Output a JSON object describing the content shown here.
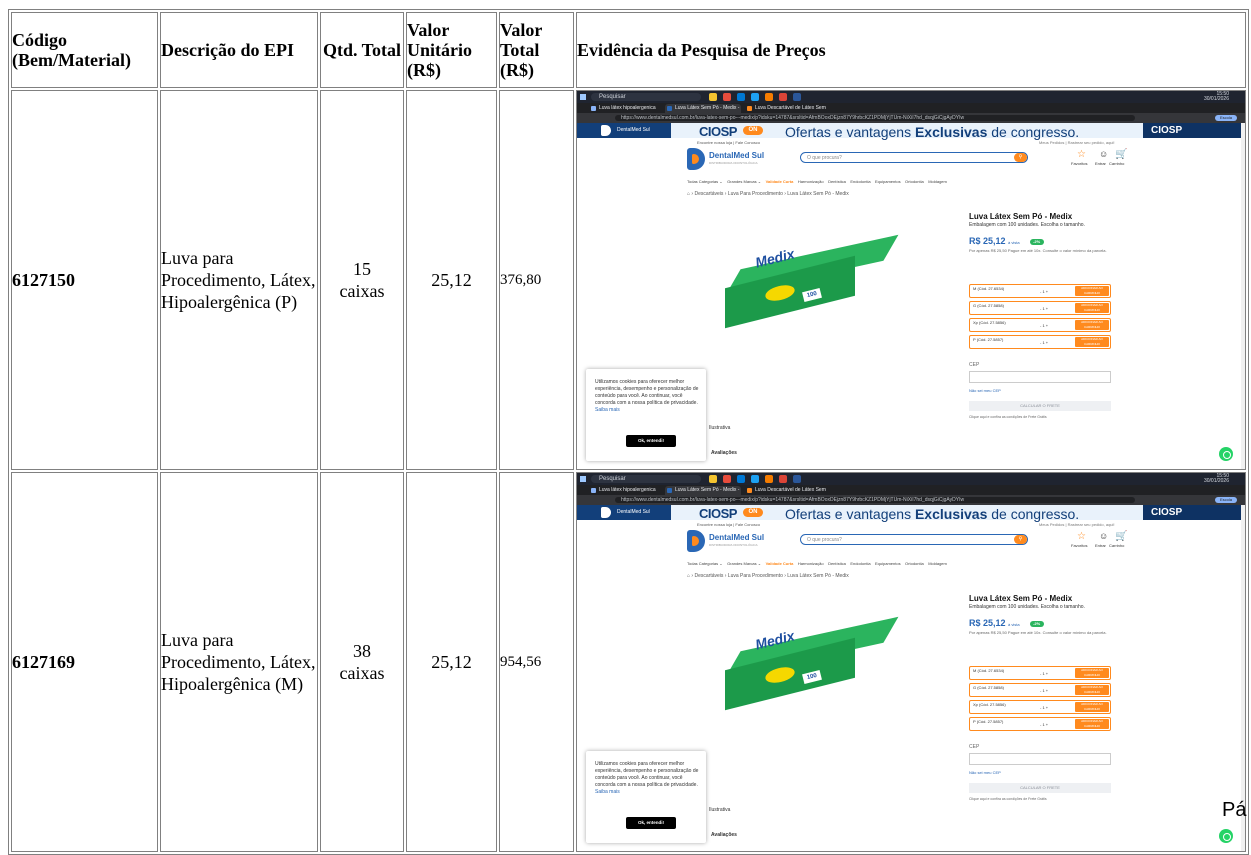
{
  "table": {
    "headers": {
      "code": "Código (Bem/Material)",
      "description": "Descrição do EPI",
      "qty": "Qtd. Total",
      "unit_value": "Valor Unitário (R$)",
      "total_value": "Valor Total (R$)",
      "evidence": "Evidência da Pesquisa de Preços"
    },
    "rows": [
      {
        "code": "6127150",
        "description": "Luva para Procedimento, Látex, Hipoalergênica (P)",
        "qty": "15 caixas",
        "unit_value": "25,12",
        "total_value": "376,80"
      },
      {
        "code": "6127169",
        "description": "Luva para Procedimento, Látex, Hipoalergênica (M)",
        "qty": "38 caixas",
        "unit_value": "25,12",
        "total_value": "954,56"
      }
    ]
  },
  "screenshot": {
    "taskbar_search": "Pesquisar",
    "clock_time": "15:50",
    "clock_date": "30/01/2026",
    "tabs": [
      "Luva látex hipoalergenica sem ...",
      "Luva Látex Sem Pó - Medix - D",
      "Luva Descartável de Látex Sem"
    ],
    "url": "https://www.dentalmedsul.com.br/luva-latex-sem-po---medix/p?idsku=14787&srsltid=AfmBOoxDEjzn87Y9hrbcKZ1PDMjYjTUm-NiXiI7hd_dsqjGiCjgAyDYIw",
    "profile": "Escola",
    "banner_left": "DentalMed Sul",
    "banner_ciosp": "CIOSP",
    "banner_on": "ON",
    "banner_offer_prefix": "Ofertas e vantagens",
    "banner_offer_bold": "Exclusivas",
    "banner_offer_suffix": "de congresso.",
    "banner_right": "CIOSP",
    "store_locator": "Encontre nossa loja | Fale Conosco",
    "account_links": "Meus Pedidos | Rastrear seu pedido, aqui!",
    "store_name": "DentalMed Sul",
    "store_tagline": "DISTRIBUIDORA ODONTOLÓGICA",
    "search_placeholder": "O que procura?",
    "action_favorites": "Favoritos",
    "action_login": "Entrar",
    "action_cart": "Carrinho",
    "nav_items": [
      "Todas Categorias",
      "Grandes Marcas",
      "Validade Curta",
      "Harmonização",
      "Dentística",
      "Endodontia",
      "Equipamentos",
      "Ortodontia",
      "Moldagem"
    ],
    "breadcrumb": "› Descartáveis › Luva Para Procedimento › Luva Látex Sem Pó - Medix",
    "product_brand": "Medix",
    "product_title": "Luva Látex Sem Pó - Medix",
    "product_subtitle": "Embalagem com 100 unidades. Escolha o tamanho.",
    "price": "R$ 25,12",
    "price_unit": "à vista",
    "discount": "-2%",
    "price_note": "Por apenas R$ 25,50 Pague em até 10x. Consulte o valor mínimo da parcela.",
    "sizes": [
      {
        "label": "M (Cód. 27.6534)",
        "qty": "- 1 +"
      },
      {
        "label": "G (Cód. 27.5858)",
        "qty": "- 1 +"
      },
      {
        "label": "Xp (Cód. 27.5856)",
        "qty": "- 1 +"
      },
      {
        "label": "P (Cód. 27.5857)",
        "qty": "- 1 +"
      }
    ],
    "add_to_cart": "ADICIONAR AO CARRINHO",
    "cep_label": "CEP",
    "cep_link": "Não sei meu CEP",
    "calc_button": "CALCULAR O FRETE",
    "conditions": "Clique aqui e confira as condições de Frete Grátis",
    "cookie_text": "Utilizamos cookies para oferecer melhor experiência, desempenho e personalização de conteúdo para você. Ao continuar, você concorda com a nossa política de privacidade.",
    "cookie_link": "Saiba mais",
    "cookie_button": "Ok, entendi!",
    "illustrative": "Ilustrativa",
    "reviews": "Avaliações"
  },
  "page_fragment": "Pá"
}
